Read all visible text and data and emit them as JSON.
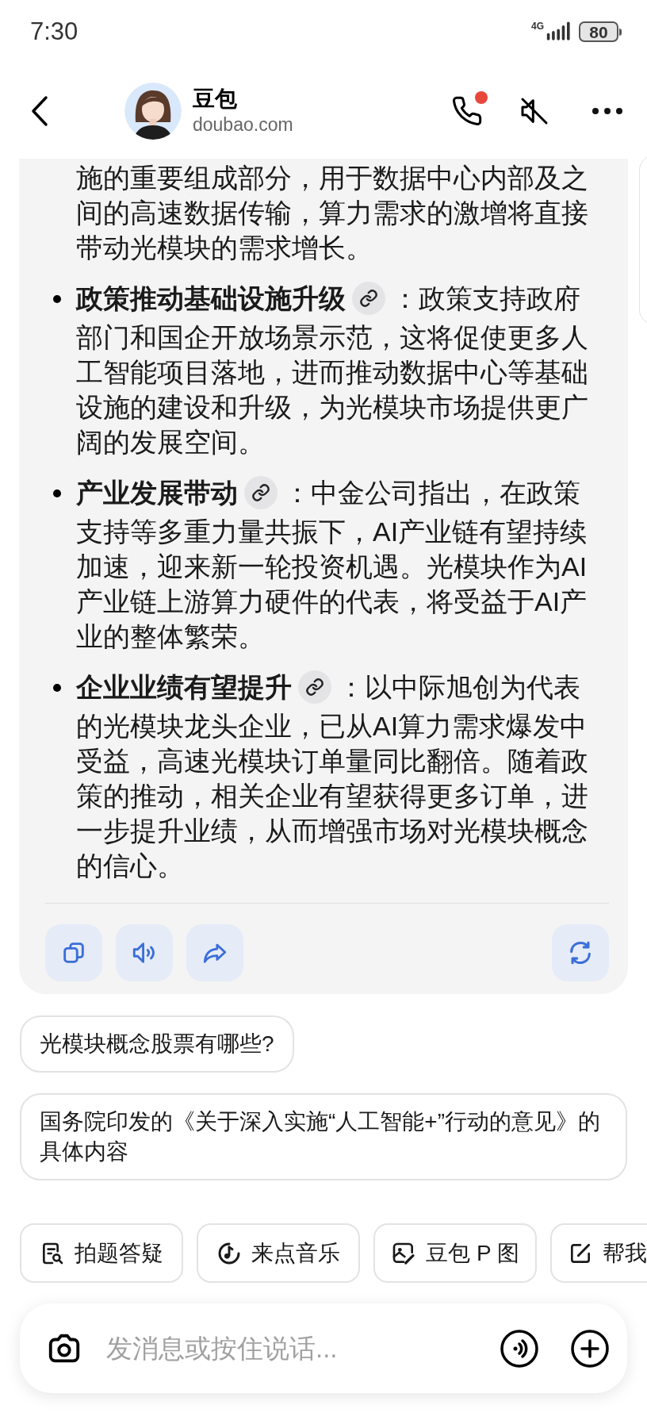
{
  "status_bar": {
    "time": "7:30",
    "network": "4G",
    "battery": "80"
  },
  "header": {
    "title": "豆包",
    "subtitle": "doubao.com",
    "call_badge": true,
    "muted": true
  },
  "message": {
    "lead": "施的重要组成部分，用于数据中心内部及之间的高速数据传输，算力需求的激增将直接带动光模块的需求增长。",
    "bullets": [
      {
        "title": "政策推动基础设施升级",
        "text": "：政策支持政府部门和国企开放场景示范，这将促使更多人工智能项目落地，进而推动数据中心等基础设施的建设和升级，为光模块市场提供更广阔的发展空间。"
      },
      {
        "title": "产业发展带动",
        "text": "：中金公司指出，在政策支持等多重力量共振下，AI产业链有望持续加速，迎来新一轮投资机遇。光模块作为AI产业链上游算力硬件的代表，将受益于AI产业的整体繁荣。"
      },
      {
        "title": "企业业绩有望提升",
        "text": "：以中际旭创为代表的光模块龙头企业，已从AI算力需求爆发中受益，高速光模块订单量同比翻倍。随着政策的推动，相关企业有望获得更多订单，进一步提升业绩，从而增强市场对光模块概念的信心。"
      }
    ]
  },
  "suggestions": [
    "光模块概念股票有哪些?",
    "国务院印发的《关于深入实施“人工智能+”行动的意见》的具体内容"
  ],
  "quick_actions": [
    {
      "kind": "scan",
      "label": "拍题答疑"
    },
    {
      "kind": "music",
      "label": "来点音乐"
    },
    {
      "kind": "image",
      "label": "豆包 P 图"
    },
    {
      "kind": "write",
      "label": "帮我"
    }
  ],
  "composer": {
    "placeholder": "发消息或按住说话..."
  }
}
